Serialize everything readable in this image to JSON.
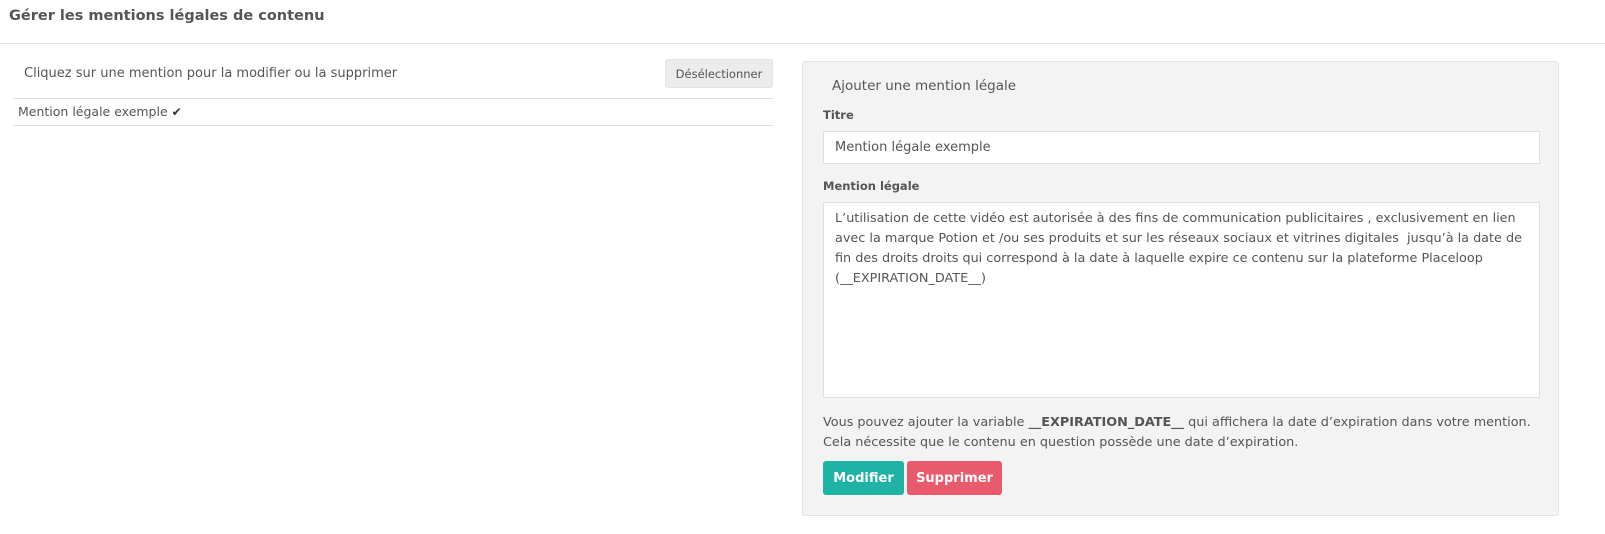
{
  "header": {
    "title": "Gérer les mentions légales de contenu"
  },
  "list_panel": {
    "instruction": "Cliquez sur une mention pour la modifier ou la supprimer",
    "deselect_label": "Désélectionner",
    "items": [
      {
        "label": "Mention légale exemple",
        "icon": "check-icon",
        "selected": true
      }
    ]
  },
  "form_panel": {
    "title": "Ajouter une mention légale",
    "titre_label": "Titre",
    "titre_value": "Mention légale exemple",
    "mention_label": "Mention légale",
    "mention_value": "L’utilisation de cette vidéo est autorisée à des fins de communication publicitaires , exclusivement en lien avec la marque Potion et /ou ses produits et sur les réseaux sociaux et vitrines digitales  jusqu’à la date de fin des droits droits qui correspond à la date à laquelle expire ce contenu sur la plateforme Placeloop (__EXPIRATION_DATE__)",
    "help_prefix": "Vous pouvez ajouter la variable ",
    "help_variable": "__EXPIRATION_DATE__",
    "help_suffix": " qui affichera la date d’expiration dans votre mention.",
    "help_line2": "Cela nécessite que le contenu en question possède une date d’expiration.",
    "modify_label": "Modifier",
    "delete_label": "Supprimer"
  },
  "colors": {
    "modify_button": "#1fb3a6",
    "delete_button": "#e95a6c",
    "panel_background": "#f3f3f3"
  }
}
